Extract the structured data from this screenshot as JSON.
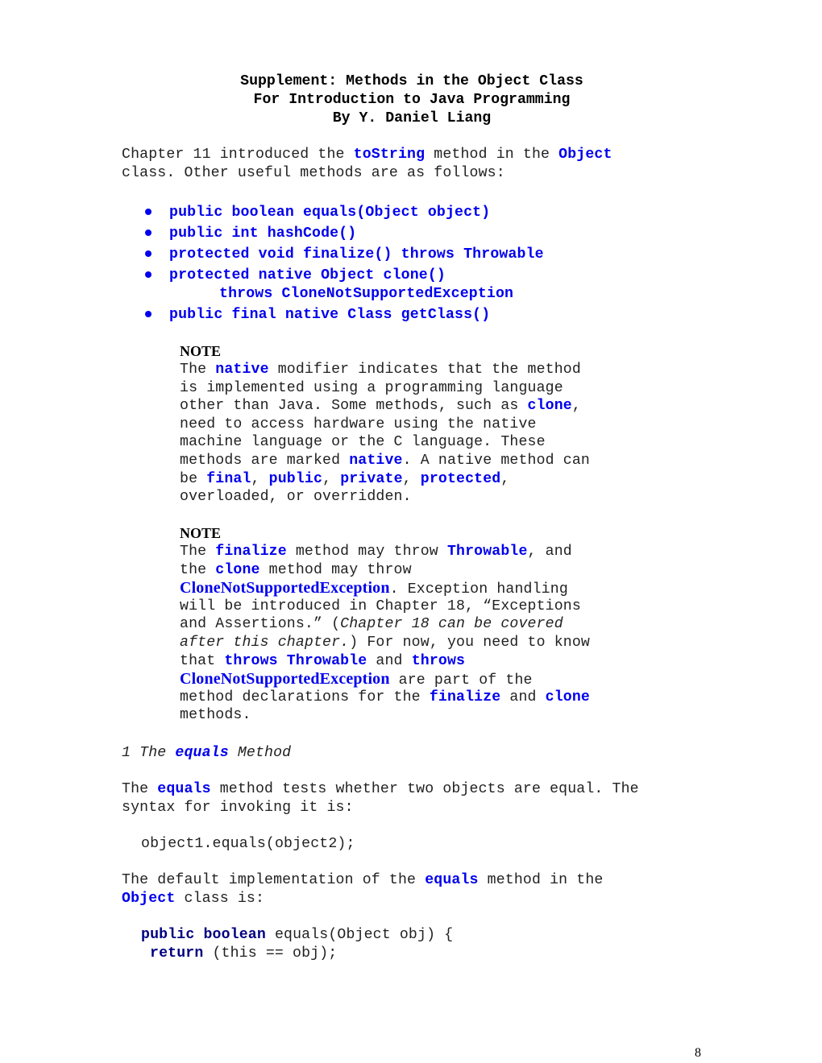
{
  "header": {
    "title_lines": [
      "Supplement: Methods in the Object Class",
      "For Introduction to Java Programming",
      "By Y. Daniel Liang"
    ]
  },
  "intro": {
    "line1": [
      {
        "t": "Chapter 11 introduced the ",
        "s": "plain"
      },
      {
        "t": "toString",
        "s": "kw"
      },
      {
        "t": " method in the ",
        "s": "plain"
      },
      {
        "t": "Object",
        "s": "kw"
      }
    ],
    "line2": "class. Other useful methods are as follows:"
  },
  "methods": [
    {
      "signature": "public boolean equals(Object object)"
    },
    {
      "signature": "public int hashCode()"
    },
    {
      "signature": "protected void finalize() throws Throwable"
    },
    {
      "signature": "protected native Object clone()",
      "continuation": "throws CloneNotSupportedException"
    },
    {
      "signature": "public final native Class getClass()"
    }
  ],
  "note1": {
    "heading": "NOTE",
    "lines": [
      [
        {
          "t": "The ",
          "s": "plain"
        },
        {
          "t": "native",
          "s": "kw"
        },
        {
          "t": " modifier indicates that the method",
          "s": "plain"
        }
      ],
      [
        {
          "t": "is implemented using a programming language",
          "s": "plain"
        }
      ],
      [
        {
          "t": "other than Java. Some methods, such as ",
          "s": "plain"
        },
        {
          "t": "clone",
          "s": "kw"
        },
        {
          "t": ",",
          "s": "plain"
        }
      ],
      [
        {
          "t": "need to access hardware using the native",
          "s": "plain"
        }
      ],
      [
        {
          "t": "machine language or the C language. These",
          "s": "plain"
        }
      ],
      [
        {
          "t": "methods are marked ",
          "s": "plain"
        },
        {
          "t": "native",
          "s": "kw"
        },
        {
          "t": ". A native method can",
          "s": "plain"
        }
      ],
      [
        {
          "t": "be ",
          "s": "plain"
        },
        {
          "t": "final",
          "s": "kw"
        },
        {
          "t": ", ",
          "s": "plain"
        },
        {
          "t": "public",
          "s": "kw"
        },
        {
          "t": ", ",
          "s": "plain"
        },
        {
          "t": "private",
          "s": "kw"
        },
        {
          "t": ", ",
          "s": "plain"
        },
        {
          "t": "protected",
          "s": "kw"
        },
        {
          "t": ",",
          "s": "plain"
        }
      ],
      [
        {
          "t": "overloaded, or overridden.",
          "s": "plain"
        }
      ]
    ]
  },
  "note2": {
    "heading": "NOTE",
    "lines": [
      [
        {
          "t": "The ",
          "s": "plain"
        },
        {
          "t": "finalize",
          "s": "kw"
        },
        {
          "t": " method may throw ",
          "s": "plain"
        },
        {
          "t": "Throwable",
          "s": "kw"
        },
        {
          "t": ", and",
          "s": "plain"
        }
      ],
      [
        {
          "t": "the ",
          "s": "plain"
        },
        {
          "t": "clone",
          "s": "kw"
        },
        {
          "t": " method may throw",
          "s": "plain"
        }
      ],
      [
        {
          "t": "CloneNotSupportedException",
          "s": "kw-serif"
        },
        {
          "t": ". Exception handling",
          "s": "plain"
        }
      ],
      [
        {
          "t": "will be introduced in Chapter 18, “Exceptions",
          "s": "plain"
        }
      ],
      [
        {
          "t": "and Assertions.” (",
          "s": "plain"
        },
        {
          "t": "Chapter 18 can be covered",
          "s": "it"
        }
      ],
      [
        {
          "t": "after this chapter.",
          "s": "it"
        },
        {
          "t": ") For now, you need to know",
          "s": "plain"
        }
      ],
      [
        {
          "t": "that ",
          "s": "plain"
        },
        {
          "t": "throws Throwable",
          "s": "kw"
        },
        {
          "t": " and ",
          "s": "plain"
        },
        {
          "t": "throws",
          "s": "kw"
        }
      ],
      [
        {
          "t": "CloneNotSupportedException",
          "s": "kw-serif"
        },
        {
          "t": " are part of the",
          "s": "plain"
        }
      ],
      [
        {
          "t": "method declarations for the ",
          "s": "plain"
        },
        {
          "t": "finalize",
          "s": "kw"
        },
        {
          "t": " and ",
          "s": "plain"
        },
        {
          "t": "clone",
          "s": "kw"
        }
      ],
      [
        {
          "t": "methods.",
          "s": "plain"
        }
      ]
    ]
  },
  "section1": {
    "heading": [
      {
        "t": "1 The ",
        "s": "it"
      },
      {
        "t": "equals",
        "s": "kw-it"
      },
      {
        "t": " Method",
        "s": "it"
      }
    ],
    "para1": [
      [
        {
          "t": "The ",
          "s": "plain"
        },
        {
          "t": "equals",
          "s": "kw"
        },
        {
          "t": " method tests whether two objects are equal. The",
          "s": "plain"
        }
      ],
      [
        {
          "t": "syntax for invoking it is:",
          "s": "plain"
        }
      ]
    ],
    "code1": "object1.equals(object2);",
    "para2": [
      [
        {
          "t": "The default implementation of the ",
          "s": "plain"
        },
        {
          "t": "equals",
          "s": "kw"
        },
        {
          "t": " method in the",
          "s": "plain"
        }
      ],
      [
        {
          "t": "Object",
          "s": "kw"
        },
        {
          "t": " class is:",
          "s": "plain"
        }
      ]
    ],
    "code2": [
      [
        {
          "t": "public boolean",
          "s": "navy"
        },
        {
          "t": " equals(Object obj) {",
          "s": "plain"
        }
      ],
      [
        {
          "t": "return",
          "s": "navy"
        },
        {
          "t": " (this == obj);",
          "s": "plain"
        }
      ]
    ]
  },
  "footer": {
    "page_number": "8"
  }
}
